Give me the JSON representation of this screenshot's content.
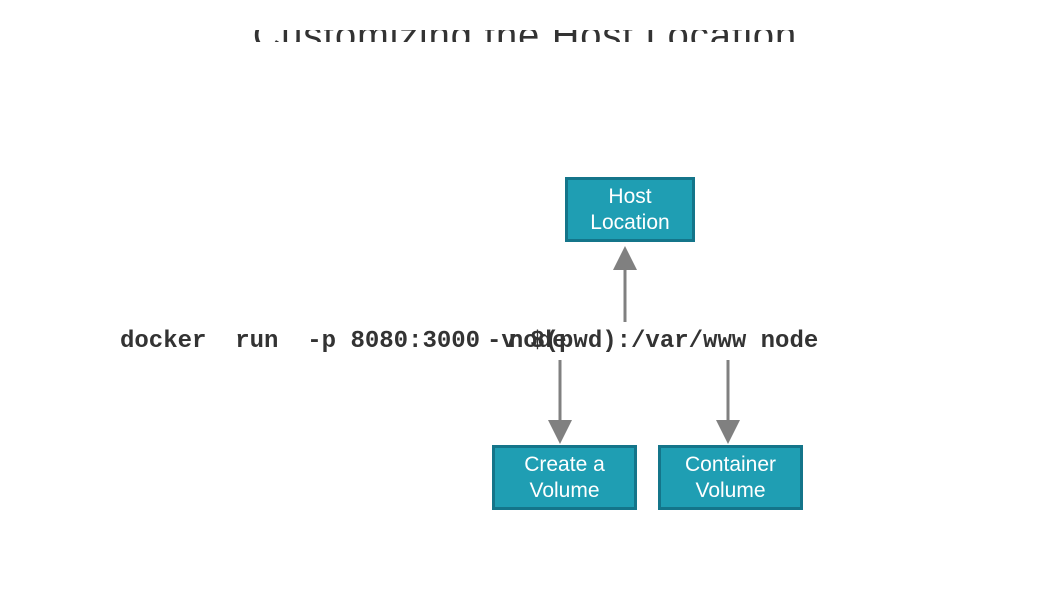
{
  "title": {
    "truncated_text": "Customizing the Host Location"
  },
  "command": {
    "base": "docker  run  -p 8080:3000  node",
    "overlap": "-v $(pwd):/var/www node"
  },
  "labels": {
    "host_location_line1": "Host",
    "host_location_line2": "Location",
    "create_volume_line1": "Create a",
    "create_volume_line2": "Volume",
    "container_volume_line1": "Container",
    "container_volume_line2": "Volume"
  },
  "chart_data": {
    "type": "diagram",
    "description": "Docker run command annotation diagram",
    "command_string": "docker run -p 8080:3000 -v $(pwd):/var/www node",
    "annotations": [
      {
        "label": "Host Location",
        "points_to": "$(pwd)",
        "direction": "above"
      },
      {
        "label": "Create a Volume",
        "points_to": "-v",
        "direction": "below"
      },
      {
        "label": "Container Volume",
        "points_to": "/var/www",
        "direction": "below"
      }
    ]
  }
}
